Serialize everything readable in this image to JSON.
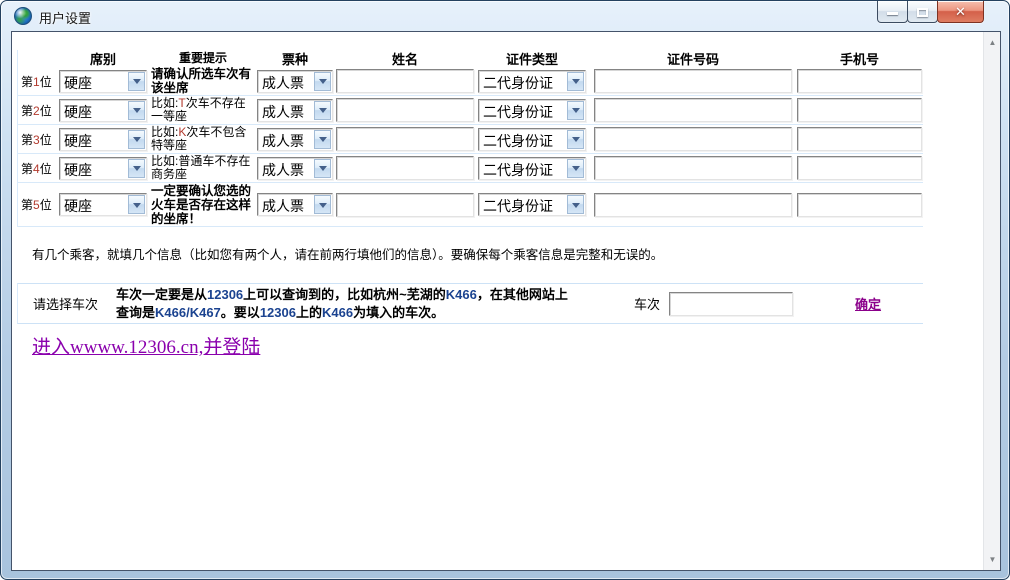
{
  "window": {
    "title": "用户设置"
  },
  "icons": {
    "app": "globe",
    "close_glyph": "✕",
    "scroll_up": "▲",
    "scroll_down": "▼"
  },
  "colors": {
    "highlight_red": "#b23a2e",
    "highlight_blue": "#1b4390",
    "link_purple": "#8b008b",
    "login_link_purple": "#8a00ad"
  },
  "table": {
    "headers": {
      "seat": "席别",
      "notice": "重要提示",
      "ticket": "票种",
      "name": "姓名",
      "id_type": "证件类型",
      "id_number": "证件号码",
      "phone": "手机号"
    },
    "rows": [
      {
        "pre": "第",
        "num": "1",
        "suf": "位",
        "seat": "硬座",
        "ticket": "成人票",
        "id_type": "二代身份证",
        "name_value": "",
        "id_number_value": "",
        "phone_value": "",
        "notice": [
          {
            "t": "请确认所选车次有该坐席"
          }
        ]
      },
      {
        "pre": "第",
        "num": "2",
        "suf": "位",
        "seat": "硬座",
        "ticket": "成人票",
        "id_type": "二代身份证",
        "name_value": "",
        "id_number_value": "",
        "phone_value": "",
        "notice": [
          {
            "t": "比如:"
          },
          {
            "t": "T",
            "c": "seg-red"
          },
          {
            "t": "次车不存在一等座"
          }
        ]
      },
      {
        "pre": "第",
        "num": "3",
        "suf": "位",
        "seat": "硬座",
        "ticket": "成人票",
        "id_type": "二代身份证",
        "name_value": "",
        "id_number_value": "",
        "phone_value": "",
        "notice": [
          {
            "t": "比如:"
          },
          {
            "t": "K",
            "c": "seg-red"
          },
          {
            "t": "次车不包含特等座"
          }
        ]
      },
      {
        "pre": "第",
        "num": "4",
        "suf": "位",
        "seat": "硬座",
        "ticket": "成人票",
        "id_type": "二代身份证",
        "name_value": "",
        "id_number_value": "",
        "phone_value": "",
        "notice": [
          {
            "t": "比如:普通车不存在商务座"
          }
        ]
      },
      {
        "pre": "第",
        "num": "5",
        "suf": "位",
        "seat": "硬座",
        "ticket": "成人票",
        "id_type": "二代身份证",
        "name_value": "",
        "id_number_value": "",
        "phone_value": "",
        "notice": [
          {
            "t": "一定要确认您选的火车是否存在这样的坐席！"
          }
        ]
      }
    ]
  },
  "instructions": "有几个乘客，就填几个信息（比如您有两个人，请在前两行填他们的信息）。要确保每个乘客信息是完整和无误的。",
  "train_section": {
    "label": "请选择车次",
    "notice": [
      {
        "t": "车次一定要是从"
      },
      {
        "t": "12306",
        "c": "seg-blue"
      },
      {
        "t": "上可以查询到的，比如杭州~芜湖的"
      },
      {
        "t": "K466",
        "c": "seg-blue"
      },
      {
        "t": "，在其他网站上查询是"
      },
      {
        "t": "K466/K467",
        "c": "seg-blue"
      },
      {
        "t": "。要以"
      },
      {
        "t": "12306",
        "c": "seg-blue"
      },
      {
        "t": "上的"
      },
      {
        "t": "K466",
        "c": "seg-blue"
      },
      {
        "t": "为填入的车次。"
      }
    ],
    "train_no_label": "车次",
    "train_no_value": "",
    "confirm": "确定"
  },
  "login_link": "进入wwww.12306.cn,并登陆"
}
